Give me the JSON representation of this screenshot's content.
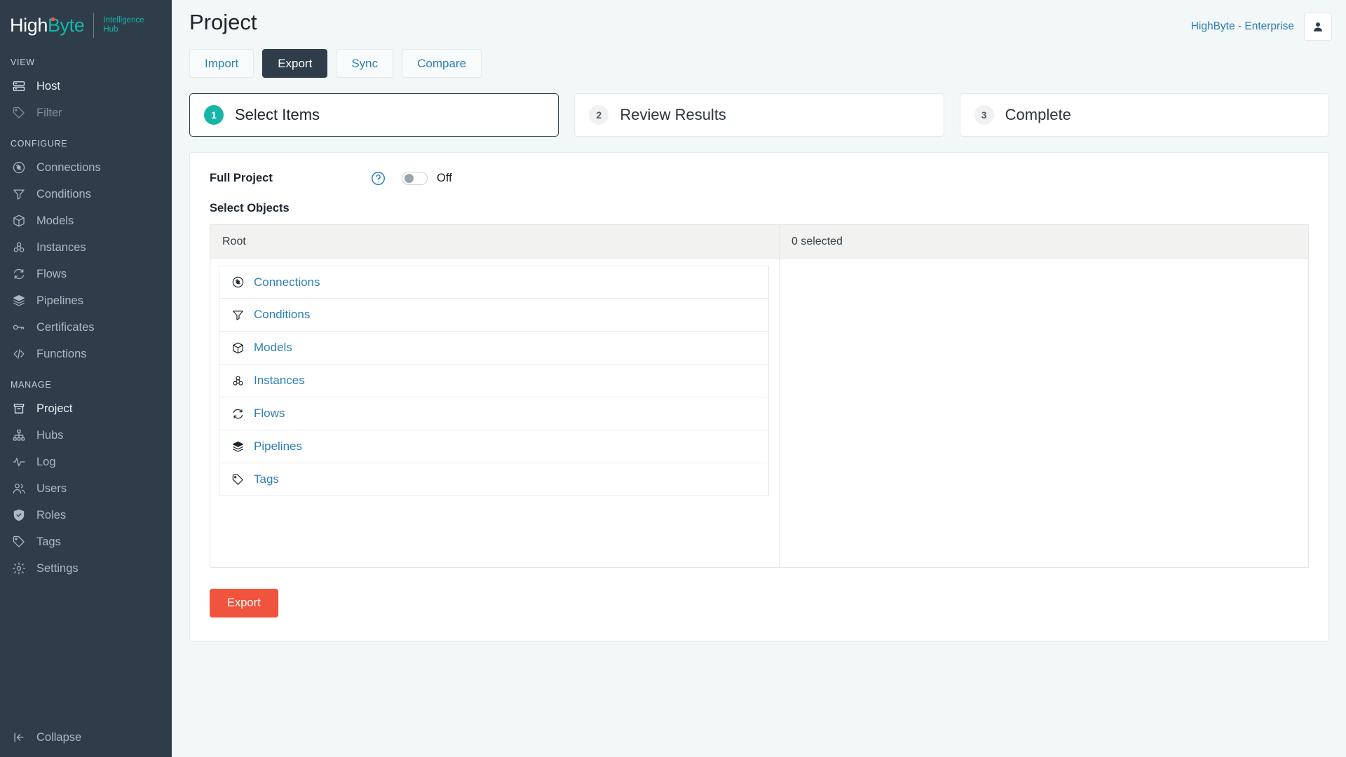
{
  "brand": {
    "name_part1": "High",
    "name_part2": "Byte",
    "subtitle_line1": "Intelligence",
    "subtitle_line2": "Hub",
    "accent_teal": "#16b5a8",
    "accent_coral": "#f0543c",
    "sidebar_bg": "#2e3d49"
  },
  "sidebar": {
    "sections": [
      {
        "title": "VIEW",
        "items": [
          {
            "label": "Host",
            "icon": "server-icon",
            "state": "bright"
          },
          {
            "label": "Filter",
            "icon": "tag-icon",
            "state": "dim"
          }
        ]
      },
      {
        "title": "CONFIGURE",
        "items": [
          {
            "label": "Connections",
            "icon": "plug-circle-icon",
            "state": "normal"
          },
          {
            "label": "Conditions",
            "icon": "funnel-icon",
            "state": "normal"
          },
          {
            "label": "Models",
            "icon": "box-icon",
            "state": "normal"
          },
          {
            "label": "Instances",
            "icon": "cubes-icon",
            "state": "normal"
          },
          {
            "label": "Flows",
            "icon": "refresh-icon",
            "state": "normal"
          },
          {
            "label": "Pipelines",
            "icon": "layers-icon",
            "state": "normal"
          },
          {
            "label": "Certificates",
            "icon": "key-icon",
            "state": "normal"
          },
          {
            "label": "Functions",
            "icon": "code-icon",
            "state": "normal"
          }
        ]
      },
      {
        "title": "MANAGE",
        "items": [
          {
            "label": "Project",
            "icon": "archive-icon",
            "state": "bright"
          },
          {
            "label": "Hubs",
            "icon": "sitemap-icon",
            "state": "normal"
          },
          {
            "label": "Log",
            "icon": "pulse-icon",
            "state": "normal"
          },
          {
            "label": "Users",
            "icon": "users-icon",
            "state": "normal"
          },
          {
            "label": "Roles",
            "icon": "shield-check-icon",
            "state": "normal"
          },
          {
            "label": "Tags",
            "icon": "tag-icon",
            "state": "normal"
          },
          {
            "label": "Settings",
            "icon": "gear-icon",
            "state": "normal"
          }
        ]
      }
    ],
    "collapse": {
      "label": "Collapse",
      "icon": "collapse-left-icon"
    }
  },
  "header": {
    "title": "Project",
    "org": "HighByte - Enterprise",
    "avatar_icon": "user-icon"
  },
  "tabs": [
    {
      "label": "Import",
      "active": false
    },
    {
      "label": "Export",
      "active": true
    },
    {
      "label": "Sync",
      "active": false
    },
    {
      "label": "Compare",
      "active": false
    }
  ],
  "steps": [
    {
      "number": "1",
      "label": "Select Items",
      "active": true
    },
    {
      "number": "2",
      "label": "Review Results",
      "active": false
    },
    {
      "number": "3",
      "label": "Complete",
      "active": false
    }
  ],
  "form": {
    "full_project_label": "Full Project",
    "help_icon": "question-circle-icon",
    "toggle_state": "Off",
    "toggle_on": false,
    "select_objects_label": "Select Objects"
  },
  "selector": {
    "left_header": "Root",
    "right_header": "0 selected",
    "objects": [
      {
        "label": "Connections",
        "icon": "plug-circle-icon"
      },
      {
        "label": "Conditions",
        "icon": "funnel-icon"
      },
      {
        "label": "Models",
        "icon": "box-icon"
      },
      {
        "label": "Instances",
        "icon": "cubes-icon"
      },
      {
        "label": "Flows",
        "icon": "refresh-icon"
      },
      {
        "label": "Pipelines",
        "icon": "layers-icon"
      },
      {
        "label": "Tags",
        "icon": "tag-icon"
      }
    ]
  },
  "actions": {
    "export_label": "Export"
  }
}
